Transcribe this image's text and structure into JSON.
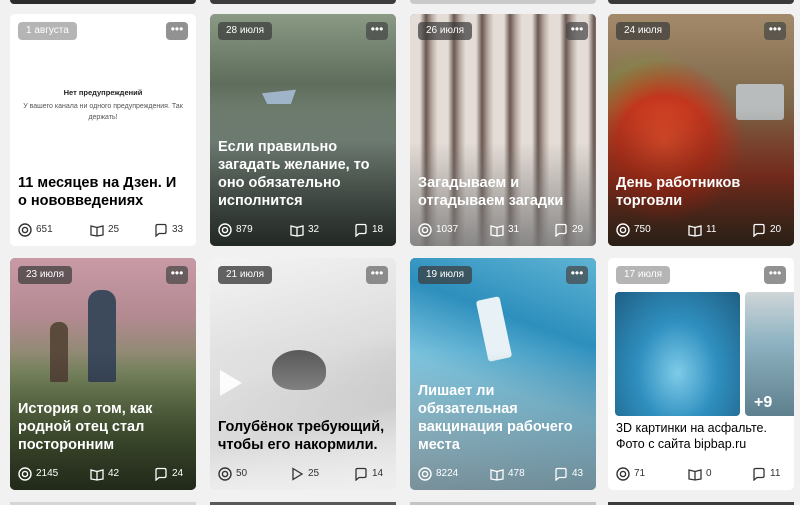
{
  "cards": [
    {
      "date": "1 августа",
      "title": "11 месяцев на Дзен. И о нововведениях",
      "views": "651",
      "reads": "25",
      "comments": "33",
      "banner_title": "Нет предупреждений",
      "banner_text": "У вашего канала ни одного предупреждения. Так держать!"
    },
    {
      "date": "28 июля",
      "title": "Если правильно загадать желание, то оно обязательно исполнится",
      "views": "879",
      "reads": "32",
      "comments": "18"
    },
    {
      "date": "26 июля",
      "title": "Загадываем и отгадываем загадки",
      "views": "1037",
      "reads": "31",
      "comments": "29"
    },
    {
      "date": "24 июля",
      "title": "День работников торговли",
      "views": "750",
      "reads": "11",
      "comments": "20"
    },
    {
      "date": "23 июля",
      "title": "История о том, как родной отец стал посторонним",
      "views": "2145",
      "reads": "42",
      "comments": "24"
    },
    {
      "date": "21 июля",
      "title": "Голубёнок требующий, чтобы его накормили.",
      "views": "50",
      "reads": "25",
      "comments": "14"
    },
    {
      "date": "19 июля",
      "title": "Лишает ли обязательная вакцинация рабочего места",
      "views": "8224",
      "reads": "478",
      "comments": "43"
    },
    {
      "date": "17 июля",
      "title": "3D картинки на асфальте. Фото с сайта bipbap.ru",
      "views": "71",
      "reads": "0",
      "comments": "11",
      "extra": "+9"
    }
  ],
  "more_glyph": "•••",
  "icons": {
    "views": "eye-icon",
    "reads": "book-icon",
    "comments": "comment-icon",
    "plays": "play-icon"
  }
}
